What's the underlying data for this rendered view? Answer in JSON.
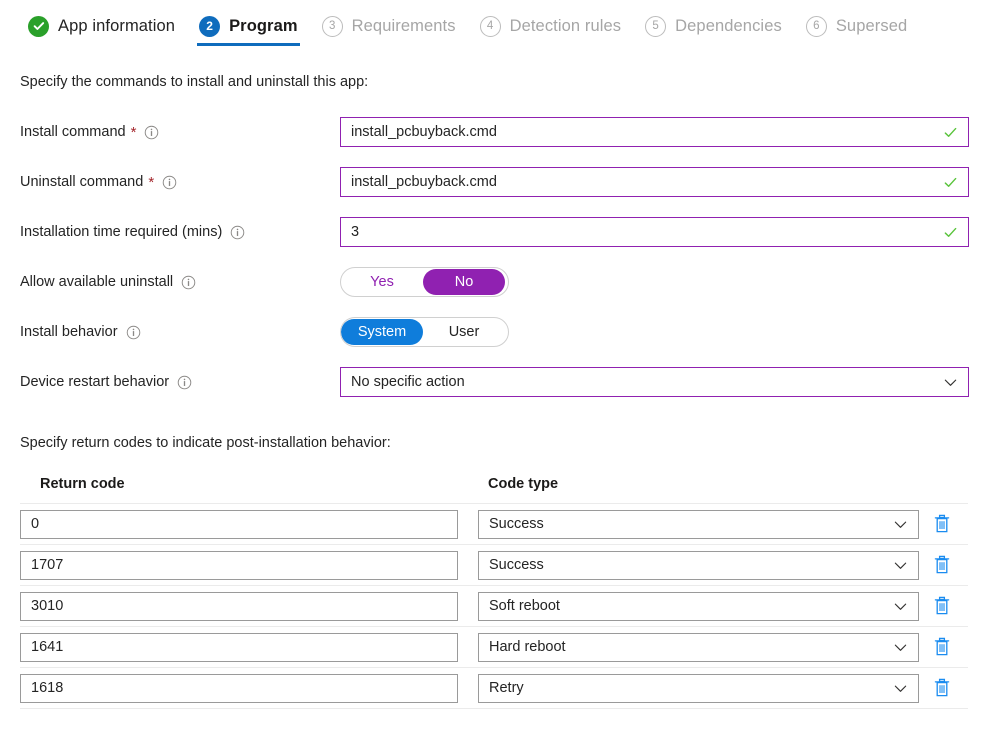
{
  "wizard": {
    "tabs": [
      {
        "badge": "check-icon",
        "label": "App information",
        "state": "done"
      },
      {
        "badge": "2",
        "label": "Program",
        "state": "current"
      },
      {
        "badge": "3",
        "label": "Requirements",
        "state": "pending"
      },
      {
        "badge": "4",
        "label": "Detection rules",
        "state": "pending"
      },
      {
        "badge": "5",
        "label": "Dependencies",
        "state": "pending"
      },
      {
        "badge": "6",
        "label": "Supersed",
        "state": "pending"
      }
    ]
  },
  "program": {
    "intro": "Specify the commands to install and uninstall this app:",
    "fields": {
      "install_command": {
        "label": "Install command",
        "required": "*",
        "value": "install_pcbuyback.cmd",
        "valid": "valid-check-icon"
      },
      "uninstall_command": {
        "label": "Uninstall command",
        "required": "*",
        "value": "install_pcbuyback.cmd",
        "valid": "valid-check-icon"
      },
      "install_time": {
        "label": "Installation time required (mins)",
        "value": "3",
        "valid": "valid-check-icon"
      },
      "allow_available_uninstall": {
        "label": "Allow available uninstall",
        "option_off": "Yes",
        "option_on": "No",
        "selected": "No"
      },
      "install_behavior": {
        "label": "Install behavior",
        "option_on": "System",
        "option_off": "User",
        "selected": "System"
      },
      "device_restart_behavior": {
        "label": "Device restart behavior",
        "value": "No specific action"
      }
    }
  },
  "return_codes": {
    "intro": "Specify return codes to indicate post-installation behavior:",
    "columns": {
      "code": "Return code",
      "type": "Code type"
    },
    "rows": [
      {
        "code": "0",
        "type": "Success"
      },
      {
        "code": "1707",
        "type": "Success"
      },
      {
        "code": "3010",
        "type": "Soft reboot"
      },
      {
        "code": "1641",
        "type": "Hard reboot"
      },
      {
        "code": "1618",
        "type": "Retry"
      }
    ]
  },
  "colors": {
    "accent_blue": "#0f6cbd",
    "toggle_blue": "#0f7ddb",
    "accent_purple": "#9021b1",
    "success_green": "#2aa02a",
    "required_red": "#a4262c",
    "trash_blue": "#1a8cf0"
  }
}
